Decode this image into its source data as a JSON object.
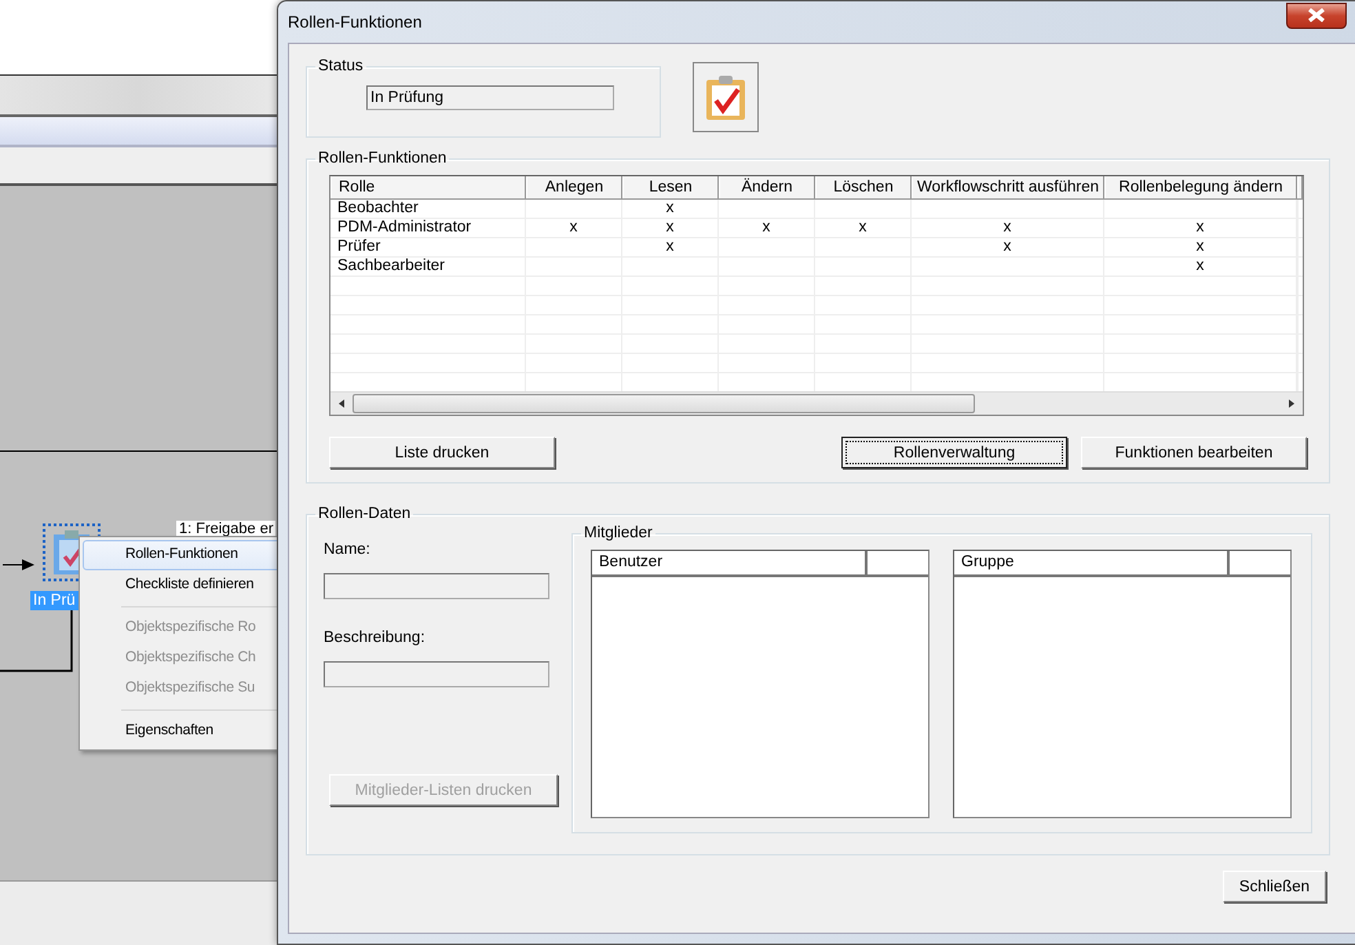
{
  "background_window": {
    "node": {
      "label": "In Prü",
      "selected": true
    },
    "node_caption": "1: Freigabe er",
    "context_menu": [
      {
        "kind": "item",
        "label": "Rollen-Funktionen",
        "disabled": false,
        "selected": true
      },
      {
        "kind": "item",
        "label": "Checkliste definieren",
        "disabled": false,
        "selected": false
      },
      {
        "kind": "separator"
      },
      {
        "kind": "item",
        "label": "Objektspezifische Ro",
        "disabled": true,
        "selected": false
      },
      {
        "kind": "item",
        "label": "Objektspezifische Ch",
        "disabled": true,
        "selected": false
      },
      {
        "kind": "item",
        "label": "Objektspezifische Su",
        "disabled": true,
        "selected": false
      },
      {
        "kind": "separator"
      },
      {
        "kind": "item",
        "label": "Eigenschaften",
        "disabled": false,
        "selected": false
      }
    ]
  },
  "dialog": {
    "title": "Rollen-Funktionen",
    "status": {
      "legend": "Status",
      "value": "In Prüfung"
    },
    "functions": {
      "legend": "Rollen-Funktionen",
      "table": {
        "columns": [
          "Rolle",
          "Anlegen",
          "Lesen",
          "Ändern",
          "Löschen",
          "Workflowschritt ausführen",
          "Rollenbelegung ändern"
        ],
        "rows": [
          [
            "Beobachter",
            "",
            "x",
            "",
            "",
            "",
            ""
          ],
          [
            "PDM-Administrator",
            "x",
            "x",
            "x",
            "x",
            "x",
            "x"
          ],
          [
            "Prüfer",
            "",
            "x",
            "",
            "",
            "x",
            "x"
          ],
          [
            "Sachbearbeiter",
            "",
            "",
            "",
            "",
            "",
            "x"
          ]
        ]
      },
      "buttons": [
        {
          "label": "Liste drucken",
          "focused": false
        },
        {
          "label": "Rollenverwaltung",
          "focused": true
        },
        {
          "label": "Funktionen bearbeiten",
          "focused": false
        }
      ]
    },
    "role_data": {
      "legend": "Rollen-Daten",
      "name_label": "Name:",
      "description_label": "Beschreibung:",
      "print_button": {
        "label": "Mitglieder-Listen drucken",
        "disabled": true
      },
      "members": {
        "legend": "Mitglieder",
        "lists": [
          {
            "header": "Benutzer"
          },
          {
            "header": "Gruppe"
          }
        ]
      }
    },
    "close_button": "Schließen"
  }
}
